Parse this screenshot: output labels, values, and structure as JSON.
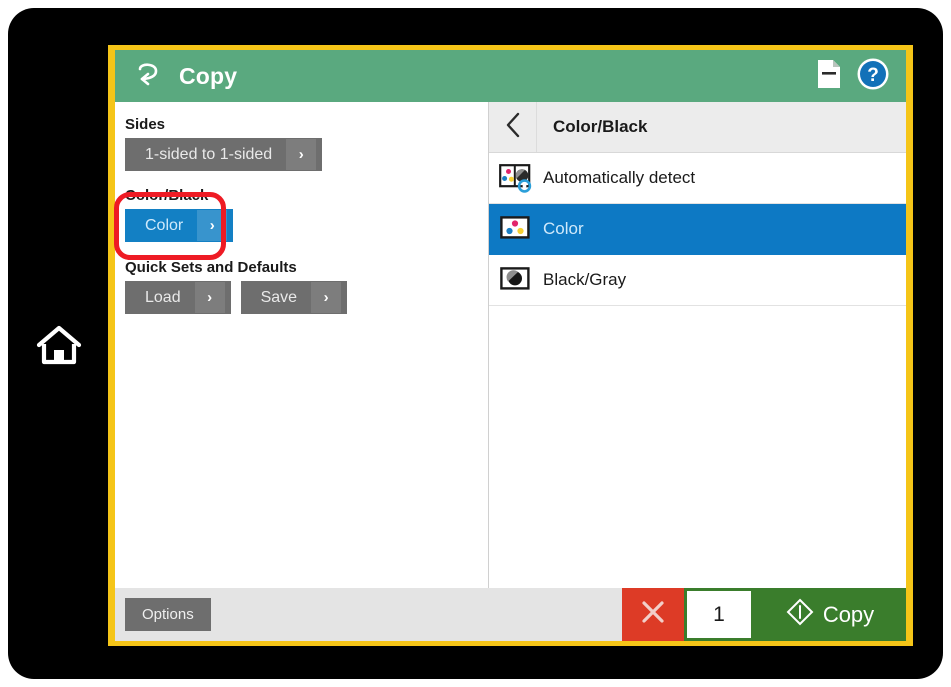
{
  "device": {
    "home_icon": "home-icon"
  },
  "header": {
    "title": "Copy",
    "back_icon": "back-arrow-icon",
    "document_icon": "document-page-icon",
    "help_icon": "help-question-icon",
    "background_color": "#5aa97f",
    "focus_border_color": "#f5c518"
  },
  "left_pane": {
    "groups": [
      {
        "label": "Sides",
        "buttons": [
          {
            "label": "1-sided to 1-sided",
            "chevron": "chevron-right-icon",
            "state": "normal"
          }
        ]
      },
      {
        "label": "Color/Black",
        "highlighted": true,
        "buttons": [
          {
            "label": "Color",
            "chevron": "chevron-right-icon",
            "state": "active"
          }
        ]
      },
      {
        "label": "Quick Sets and Defaults",
        "buttons": [
          {
            "label": "Load",
            "chevron": "chevron-right-icon",
            "state": "normal"
          },
          {
            "label": "Save",
            "chevron": "chevron-right-icon",
            "state": "normal"
          }
        ]
      }
    ],
    "annotation_color": "#ee1b24"
  },
  "right_pane": {
    "back_icon": "chevron-left-icon",
    "title": "Color/Black",
    "selected_color": "#0d79c4",
    "items": [
      {
        "label": "Automatically detect",
        "icon": "auto-detect-color-icon",
        "selected": false
      },
      {
        "label": "Color",
        "icon": "color-dots-icon",
        "selected": true
      },
      {
        "label": "Black/Gray",
        "icon": "black-gray-circle-icon",
        "selected": false
      }
    ]
  },
  "footer": {
    "options_label": "Options",
    "cancel_icon": "close-x-icon",
    "cancel_color": "#dd3b26",
    "copy_count": "1",
    "copy_label": "Copy",
    "copy_icon": "start-diamond-icon",
    "copy_color": "#3a7d2c"
  }
}
